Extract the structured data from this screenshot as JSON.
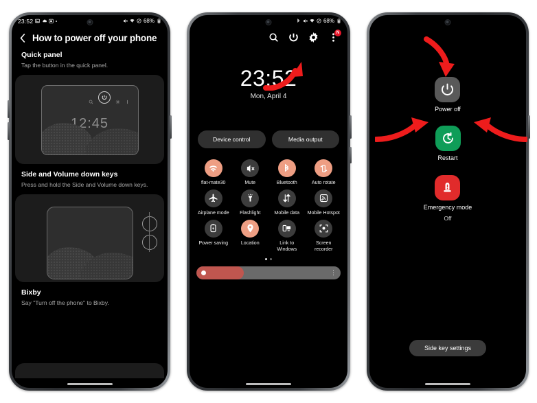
{
  "phone1": {
    "status": {
      "time": "23:52",
      "battery": "68%",
      "icons_left": [
        "image-icon",
        "cloud-icon",
        "calendar-icon",
        "dot-icon"
      ],
      "icons_right": [
        "mute-icon",
        "wifi-icon",
        "do-not-disturb-icon",
        "battery-icon"
      ]
    },
    "title": "How to power off your phone",
    "sections": [
      {
        "heading": "Quick panel",
        "body": "Tap the button in the quick panel.",
        "illustration_clock": "12:45"
      },
      {
        "heading": "Side and Volume down keys",
        "body": "Press and hold the Side and Volume down keys."
      },
      {
        "heading": "Bixby",
        "body": "Say \"Turn off the phone\" to Bixby."
      }
    ]
  },
  "phone2": {
    "status": {
      "battery": "68%",
      "icons_right": [
        "bluetooth-icon",
        "mute-icon",
        "wifi-icon",
        "do-not-disturb-icon",
        "battery-icon"
      ]
    },
    "toolbar": [
      {
        "name": "search-icon",
        "label": "Search"
      },
      {
        "name": "power-icon",
        "label": "Power"
      },
      {
        "name": "settings-gear-icon",
        "label": "Settings"
      },
      {
        "name": "more-options-icon",
        "label": "More options",
        "badge": "N"
      }
    ],
    "clock": "23:52",
    "date": "Mon, April 4",
    "buttons": {
      "device_control": "Device control",
      "media_output": "Media output"
    },
    "tiles": [
      {
        "label": "flat-mate30",
        "icon": "wifi-icon",
        "active": true
      },
      {
        "label": "Mute",
        "icon": "mute-icon",
        "active": false
      },
      {
        "label": "Bluetooth",
        "icon": "bluetooth-icon",
        "active": true
      },
      {
        "label": "Auto rotate",
        "icon": "auto-rotate-icon",
        "active": true
      },
      {
        "label": "Airplane mode",
        "icon": "airplane-icon",
        "active": false
      },
      {
        "label": "Flashlight",
        "icon": "flashlight-icon",
        "active": false
      },
      {
        "label": "Mobile data",
        "icon": "mobile-data-icon",
        "active": false
      },
      {
        "label": "Mobile Hotspot",
        "icon": "hotspot-icon",
        "active": false
      },
      {
        "label": "Power saving",
        "icon": "power-saving-icon",
        "active": false
      },
      {
        "label": "Location",
        "icon": "location-pin-icon",
        "active": true
      },
      {
        "label": "Link to Windows",
        "icon": "link-to-windows-icon",
        "active": false
      },
      {
        "label": "Screen recorder",
        "icon": "screen-recorder-icon",
        "active": false
      }
    ],
    "pages": {
      "count": 2,
      "current": 1
    },
    "brightness": {
      "percent": 33,
      "more_icon": "more-vertical-icon"
    }
  },
  "phone3": {
    "menu": [
      {
        "label": "Power off",
        "sub": "",
        "icon": "power-icon",
        "color": "#595959"
      },
      {
        "label": "Restart",
        "sub": "",
        "icon": "restart-icon",
        "color": "#0f9d58"
      },
      {
        "label": "Emergency mode",
        "sub": "Off",
        "icon": "emergency-icon",
        "color": "#e12b2b"
      }
    ],
    "side_key_settings": "Side key settings"
  },
  "annotations": {
    "arrow_color": "#ee1c1c",
    "arrow_count": 4
  },
  "theme": {
    "accent": "#ee9e83",
    "active_toggle": "#ee9e83",
    "restart_green": "#0f9d58",
    "emergency_red": "#e12b2b",
    "badge_red": "#e8162a",
    "slider_red": "#c0564f"
  }
}
